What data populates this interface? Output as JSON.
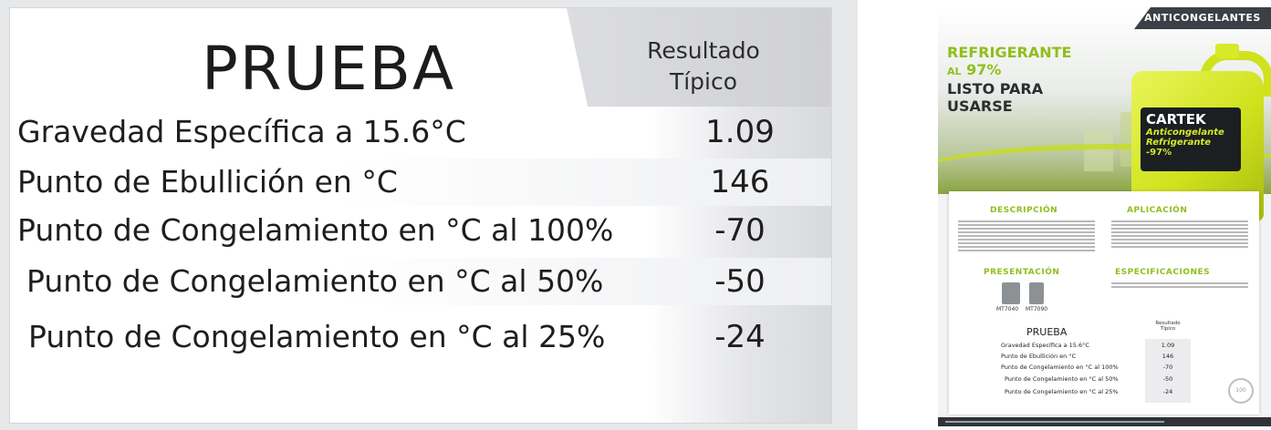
{
  "results_table": {
    "title": "PRUEBA",
    "result_header": [
      "Resultado",
      "Típico"
    ],
    "rows": [
      {
        "label": "Gravedad Específica a 15.6°C",
        "value": "1.09"
      },
      {
        "label": "Punto de Ebullición en °C",
        "value": "146"
      },
      {
        "label": "Punto de Congelamiento en °C al 100%",
        "value": "-70"
      },
      {
        "label": "Punto de Congelamiento en °C al 50%",
        "value": "-50"
      },
      {
        "label": "Punto de Congelamiento en °C al 25%",
        "value": "-24"
      }
    ]
  },
  "sheet": {
    "category": "ANTICONGELANTES",
    "headline": [
      "REFRIGERANTE",
      "AL",
      "97%",
      "LISTO PARA",
      "USARSE"
    ],
    "product": {
      "brand": "CARTEK",
      "name": [
        "Anticongelante",
        "Refrigerante"
      ],
      "percent": "-97%"
    },
    "sections": {
      "description": "DESCRIPCIÓN",
      "application": "APLICACIÓN",
      "presentation": "PRESENTACIÓN",
      "specifications": "ESPECIFICACIONES"
    },
    "packages": [
      "MT7040",
      "MT7090"
    ],
    "mini_table": {
      "title": "PRUEBA",
      "result_header": [
        "Resultado",
        "Típico"
      ],
      "rows": [
        {
          "label": "Gravedad Específica a 15.6°C",
          "value": "1.09"
        },
        {
          "label": "Punto de Ebullición en °C",
          "value": "146"
        },
        {
          "label": "Punto de Congelamiento en °C al 100%",
          "value": "-70"
        },
        {
          "label": "Punto de Congelamiento en °C al 50%",
          "value": "-50"
        },
        {
          "label": "Punto de Congelamiento en °C al 25%",
          "value": "-24"
        }
      ]
    }
  },
  "colors": {
    "accent_green": "#8fbf1c",
    "jug_yellow": "#cfe21d",
    "dark": "#2b2e31"
  }
}
